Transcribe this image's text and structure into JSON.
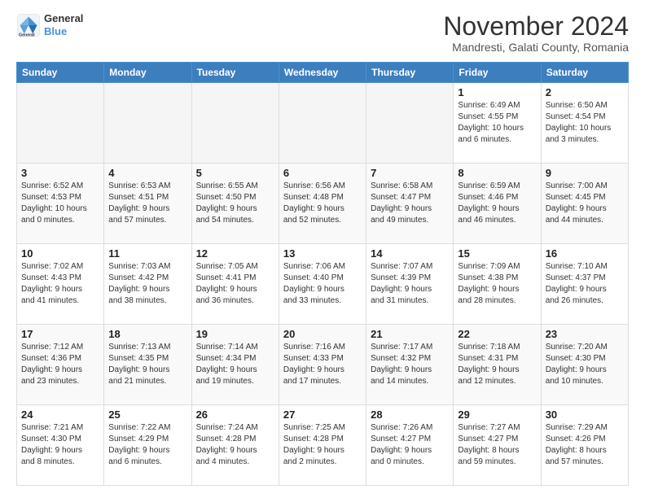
{
  "logo": {
    "line1": "General",
    "line2": "Blue"
  },
  "title": "November 2024",
  "subtitle": "Mandresti, Galati County, Romania",
  "headers": [
    "Sunday",
    "Monday",
    "Tuesday",
    "Wednesday",
    "Thursday",
    "Friday",
    "Saturday"
  ],
  "weeks": [
    [
      {
        "day": "",
        "info": ""
      },
      {
        "day": "",
        "info": ""
      },
      {
        "day": "",
        "info": ""
      },
      {
        "day": "",
        "info": ""
      },
      {
        "day": "",
        "info": ""
      },
      {
        "day": "1",
        "info": "Sunrise: 6:49 AM\nSunset: 4:55 PM\nDaylight: 10 hours\nand 6 minutes."
      },
      {
        "day": "2",
        "info": "Sunrise: 6:50 AM\nSunset: 4:54 PM\nDaylight: 10 hours\nand 3 minutes."
      }
    ],
    [
      {
        "day": "3",
        "info": "Sunrise: 6:52 AM\nSunset: 4:53 PM\nDaylight: 10 hours\nand 0 minutes."
      },
      {
        "day": "4",
        "info": "Sunrise: 6:53 AM\nSunset: 4:51 PM\nDaylight: 9 hours\nand 57 minutes."
      },
      {
        "day": "5",
        "info": "Sunrise: 6:55 AM\nSunset: 4:50 PM\nDaylight: 9 hours\nand 54 minutes."
      },
      {
        "day": "6",
        "info": "Sunrise: 6:56 AM\nSunset: 4:48 PM\nDaylight: 9 hours\nand 52 minutes."
      },
      {
        "day": "7",
        "info": "Sunrise: 6:58 AM\nSunset: 4:47 PM\nDaylight: 9 hours\nand 49 minutes."
      },
      {
        "day": "8",
        "info": "Sunrise: 6:59 AM\nSunset: 4:46 PM\nDaylight: 9 hours\nand 46 minutes."
      },
      {
        "day": "9",
        "info": "Sunrise: 7:00 AM\nSunset: 4:45 PM\nDaylight: 9 hours\nand 44 minutes."
      }
    ],
    [
      {
        "day": "10",
        "info": "Sunrise: 7:02 AM\nSunset: 4:43 PM\nDaylight: 9 hours\nand 41 minutes."
      },
      {
        "day": "11",
        "info": "Sunrise: 7:03 AM\nSunset: 4:42 PM\nDaylight: 9 hours\nand 38 minutes."
      },
      {
        "day": "12",
        "info": "Sunrise: 7:05 AM\nSunset: 4:41 PM\nDaylight: 9 hours\nand 36 minutes."
      },
      {
        "day": "13",
        "info": "Sunrise: 7:06 AM\nSunset: 4:40 PM\nDaylight: 9 hours\nand 33 minutes."
      },
      {
        "day": "14",
        "info": "Sunrise: 7:07 AM\nSunset: 4:39 PM\nDaylight: 9 hours\nand 31 minutes."
      },
      {
        "day": "15",
        "info": "Sunrise: 7:09 AM\nSunset: 4:38 PM\nDaylight: 9 hours\nand 28 minutes."
      },
      {
        "day": "16",
        "info": "Sunrise: 7:10 AM\nSunset: 4:37 PM\nDaylight: 9 hours\nand 26 minutes."
      }
    ],
    [
      {
        "day": "17",
        "info": "Sunrise: 7:12 AM\nSunset: 4:36 PM\nDaylight: 9 hours\nand 23 minutes."
      },
      {
        "day": "18",
        "info": "Sunrise: 7:13 AM\nSunset: 4:35 PM\nDaylight: 9 hours\nand 21 minutes."
      },
      {
        "day": "19",
        "info": "Sunrise: 7:14 AM\nSunset: 4:34 PM\nDaylight: 9 hours\nand 19 minutes."
      },
      {
        "day": "20",
        "info": "Sunrise: 7:16 AM\nSunset: 4:33 PM\nDaylight: 9 hours\nand 17 minutes."
      },
      {
        "day": "21",
        "info": "Sunrise: 7:17 AM\nSunset: 4:32 PM\nDaylight: 9 hours\nand 14 minutes."
      },
      {
        "day": "22",
        "info": "Sunrise: 7:18 AM\nSunset: 4:31 PM\nDaylight: 9 hours\nand 12 minutes."
      },
      {
        "day": "23",
        "info": "Sunrise: 7:20 AM\nSunset: 4:30 PM\nDaylight: 9 hours\nand 10 minutes."
      }
    ],
    [
      {
        "day": "24",
        "info": "Sunrise: 7:21 AM\nSunset: 4:30 PM\nDaylight: 9 hours\nand 8 minutes."
      },
      {
        "day": "25",
        "info": "Sunrise: 7:22 AM\nSunset: 4:29 PM\nDaylight: 9 hours\nand 6 minutes."
      },
      {
        "day": "26",
        "info": "Sunrise: 7:24 AM\nSunset: 4:28 PM\nDaylight: 9 hours\nand 4 minutes."
      },
      {
        "day": "27",
        "info": "Sunrise: 7:25 AM\nSunset: 4:28 PM\nDaylight: 9 hours\nand 2 minutes."
      },
      {
        "day": "28",
        "info": "Sunrise: 7:26 AM\nSunset: 4:27 PM\nDaylight: 9 hours\nand 0 minutes."
      },
      {
        "day": "29",
        "info": "Sunrise: 7:27 AM\nSunset: 4:27 PM\nDaylight: 8 hours\nand 59 minutes."
      },
      {
        "day": "30",
        "info": "Sunrise: 7:29 AM\nSunset: 4:26 PM\nDaylight: 8 hours\nand 57 minutes."
      }
    ]
  ]
}
